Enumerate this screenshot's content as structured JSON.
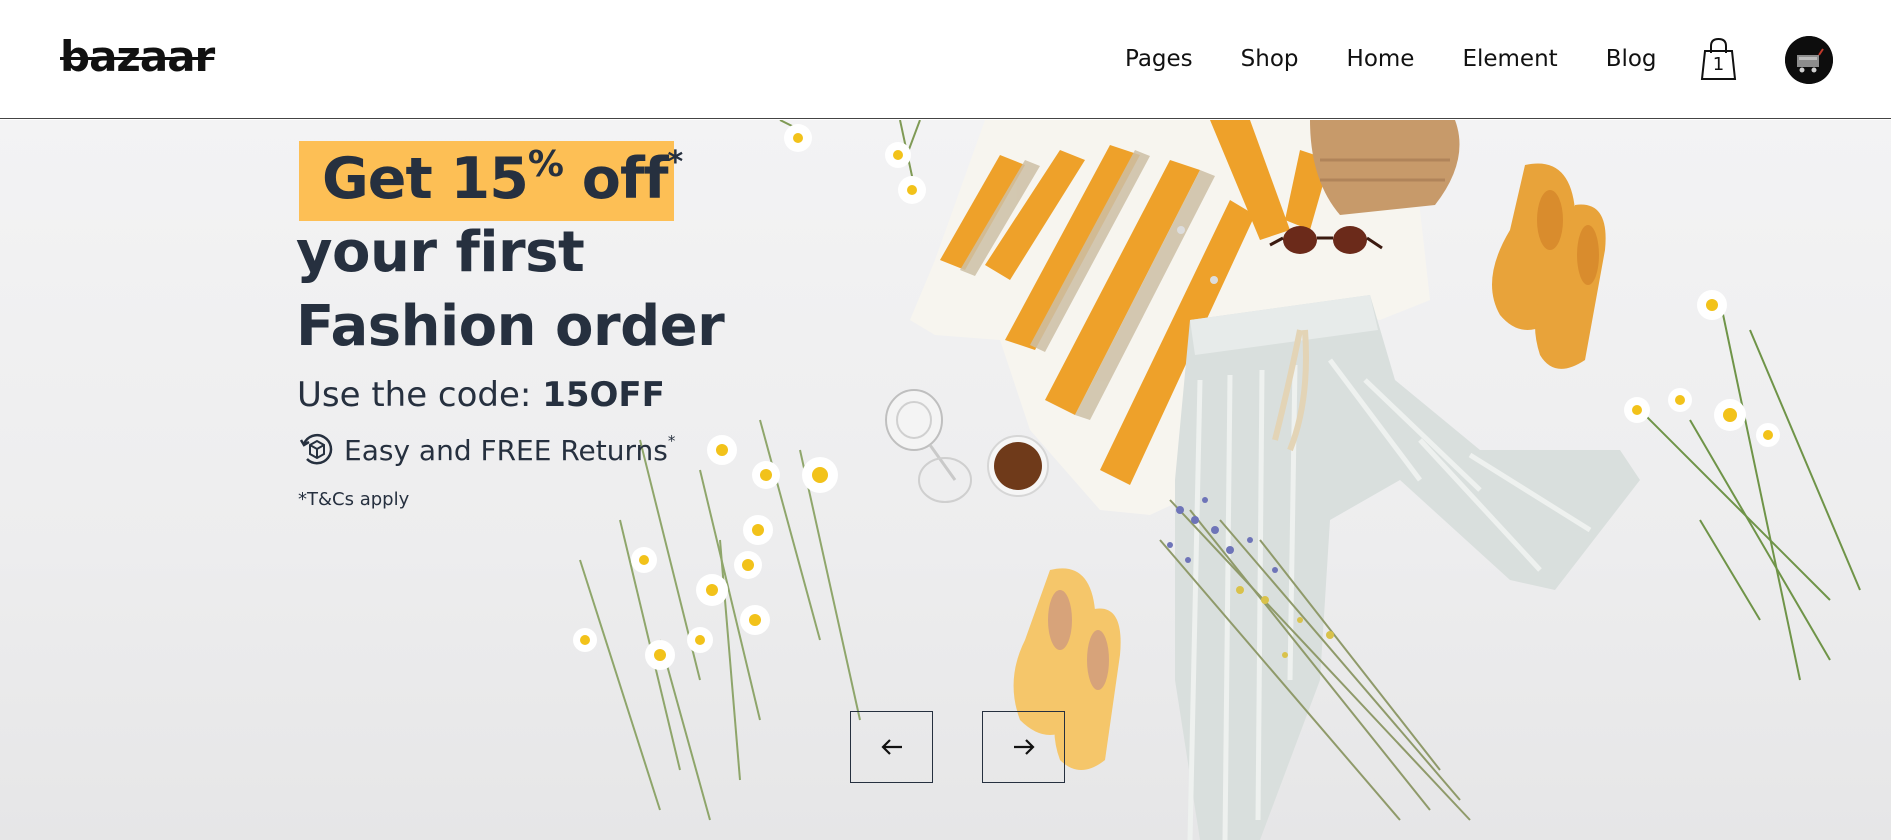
{
  "header": {
    "logo": "bazaar",
    "nav": [
      "Pages",
      "Shop",
      "Home",
      "Element",
      "Blog"
    ],
    "cart_count": "1",
    "cart_icon": "shopping-bag-icon",
    "avatar_icon": "user-avatar"
  },
  "hero": {
    "badge_prefix": "Get 15",
    "badge_percent": "%",
    "badge_suffix": " off",
    "badge_asterisk": "*",
    "headline_line1": "your first",
    "headline_line2": "Fashion order",
    "code_label": "Use the code: ",
    "code_value": "15OFF",
    "returns_icon": "returns-box-icon",
    "returns_text": "Easy and FREE Returns",
    "returns_asterisk": "*",
    "terms": "*T&Cs apply",
    "prev_icon": "arrow-left-icon",
    "next_icon": "arrow-right-icon"
  },
  "colors": {
    "badge": "#fdbf55",
    "text": "#26303f",
    "stripe_orange": "#eea12a",
    "shoe": "#e8a33a"
  }
}
